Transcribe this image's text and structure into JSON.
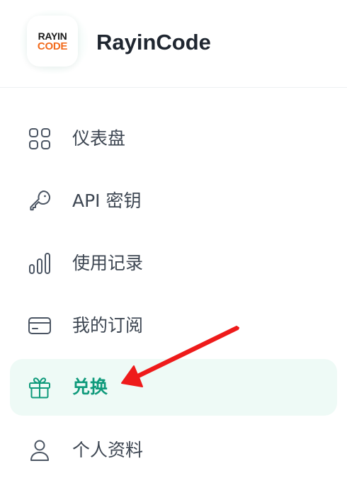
{
  "brand": {
    "logo_top": "RAYIN",
    "logo_bottom": "CODE",
    "app_name": "RayinCode"
  },
  "nav": {
    "items": [
      {
        "label": "仪表盘",
        "icon": "dashboard-grid-icon"
      },
      {
        "label": "API 密钥",
        "icon": "key-icon"
      },
      {
        "label": "使用记录",
        "icon": "bar-chart-icon"
      },
      {
        "label": "我的订阅",
        "icon": "credit-card-icon"
      },
      {
        "label": "兑换",
        "icon": "gift-icon",
        "active": true
      },
      {
        "label": "个人资料",
        "icon": "user-icon"
      }
    ]
  },
  "colors": {
    "accent": "#0f9a7b",
    "active_bg": "#eefaf6",
    "text": "#3d4652",
    "logo_orange": "#f26b1d",
    "annotation_arrow": "#ee1b1b"
  }
}
